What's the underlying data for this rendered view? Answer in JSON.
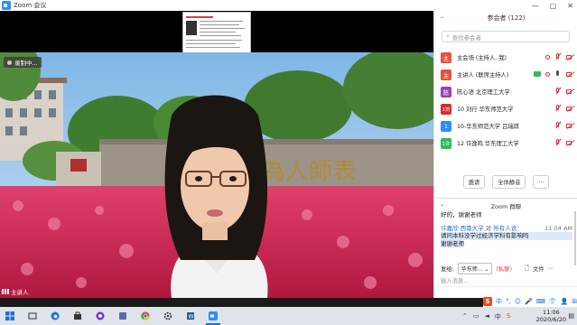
{
  "window": {
    "title": "Zoom 会议",
    "min": "—",
    "max": "▢",
    "close": "✕"
  },
  "video": {
    "recording_label": "录制中...",
    "speaker_label": "主讲人"
  },
  "participants": {
    "header": "参会者 (122)",
    "search_placeholder": "查找参会者",
    "items": [
      {
        "avatar": "主",
        "avatar_color": "#e8503a",
        "name": "主会场 (主持人, 我)"
      },
      {
        "avatar": "主",
        "avatar_color": "#e8503a",
        "name": "主讲人 (联席主持人)"
      },
      {
        "avatar": "陈",
        "avatar_color": "#9b3fb5",
        "name": "陈心语 北京理工大学"
      },
      {
        "avatar": "1刘",
        "avatar_color": "#d92b2b",
        "name": "10 刘行 华东师范大学"
      },
      {
        "avatar": "1",
        "avatar_color": "#2d8cff",
        "name": "10-华东师范大学 吕瑞琪"
      },
      {
        "avatar": "1许",
        "avatar_color": "#2dbb5b",
        "name": "12 许逸鸣 华东理工大学"
      }
    ],
    "invite": "邀请",
    "mute_all": "全体静音",
    "more": "..."
  },
  "chat": {
    "header": "Zoom 群聊",
    "messages": [
      {
        "text": "好的，谢谢老师"
      },
      {
        "from": "许嘉欣 西南大学",
        "to_label": "对",
        "to": "所有人说：",
        "time": "11:04 AM",
        "lines": [
          "请问本科没学过经济学科有影响吗",
          "谢谢老师"
        ]
      }
    ],
    "send_to_label": "发给:",
    "send_to_value": "华东师...",
    "send_to_note": "(私聊)",
    "file_label": "文件",
    "input_placeholder": "输入消息..."
  },
  "ime": {
    "logo": "S",
    "items": [
      "中",
      "°,",
      "☺",
      "🎤",
      "⌨",
      "👕",
      "👤",
      "⊞"
    ]
  },
  "taskbar": {
    "time": "11:06",
    "date": "2020/6/20",
    "lang": "中"
  },
  "colors": {
    "accent": "#2d8cff",
    "danger": "#e02828"
  }
}
